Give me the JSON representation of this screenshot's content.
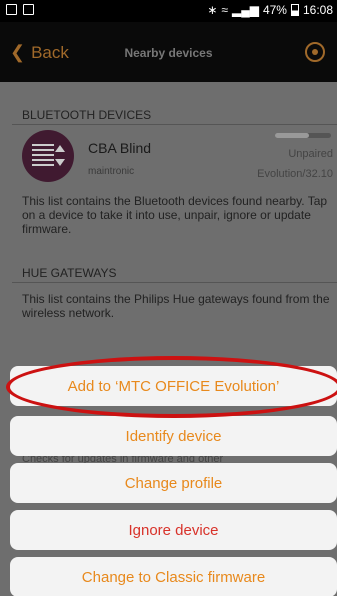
{
  "status_bar": {
    "battery": "47%",
    "time": "16:08"
  },
  "nav": {
    "back_label": "Back",
    "title": "Nearby devices"
  },
  "bluetooth": {
    "header": "BLUETOOTH DEVICES",
    "device": {
      "name": "CBA Blind",
      "manufacturer": "maintronic",
      "status": "Unpaired",
      "firmware": "Evolution/32.10",
      "signal_level": 0.6
    },
    "description": "This list contains the Bluetooth devices found nearby. Tap on a device to take it into use, unpair, ignore or update firmware."
  },
  "hue": {
    "header": "HUE GATEWAYS",
    "description": "This list contains the Philips Hue gateways found from the wireless network."
  },
  "partial_text": "Checks for updates in firmware and other",
  "actions": [
    {
      "label": "Add to ‘MTC OFFICE Evolution’"
    },
    {
      "label": "Identify device"
    },
    {
      "label": "Change profile"
    },
    {
      "label": "Ignore device"
    },
    {
      "label": "Change to Classic firmware"
    }
  ],
  "colors": {
    "accent": "#e8891c",
    "danger": "#d8322a",
    "annotation": "#cc1111"
  }
}
